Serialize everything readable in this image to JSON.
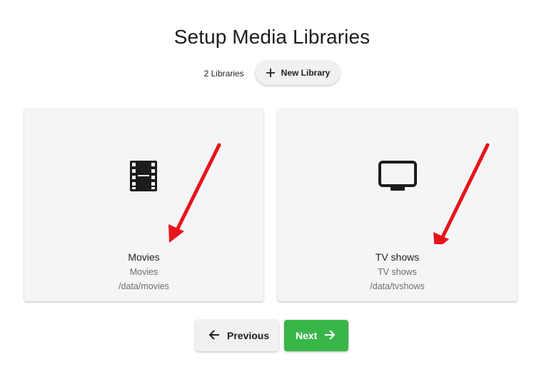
{
  "page": {
    "title": "Setup Media Libraries"
  },
  "toolbar": {
    "library_count": "2 Libraries",
    "new_library_label": "New Library",
    "new_library_icon": "plus-icon"
  },
  "libraries": [
    {
      "name": "Movies",
      "type": "Movies",
      "path": "/data/movies",
      "icon": "film-icon"
    },
    {
      "name": "TV shows",
      "type": "TV shows",
      "path": "/data/tvshows",
      "icon": "tv-icon"
    }
  ],
  "navigation": {
    "previous_label": "Previous",
    "previous_icon": "arrow-left-icon",
    "next_label": "Next",
    "next_icon": "arrow-right-icon"
  },
  "colors": {
    "next_button": "#3ab54a",
    "annotation_arrow": "#e8141a",
    "card_background": "#f5f5f7"
  }
}
